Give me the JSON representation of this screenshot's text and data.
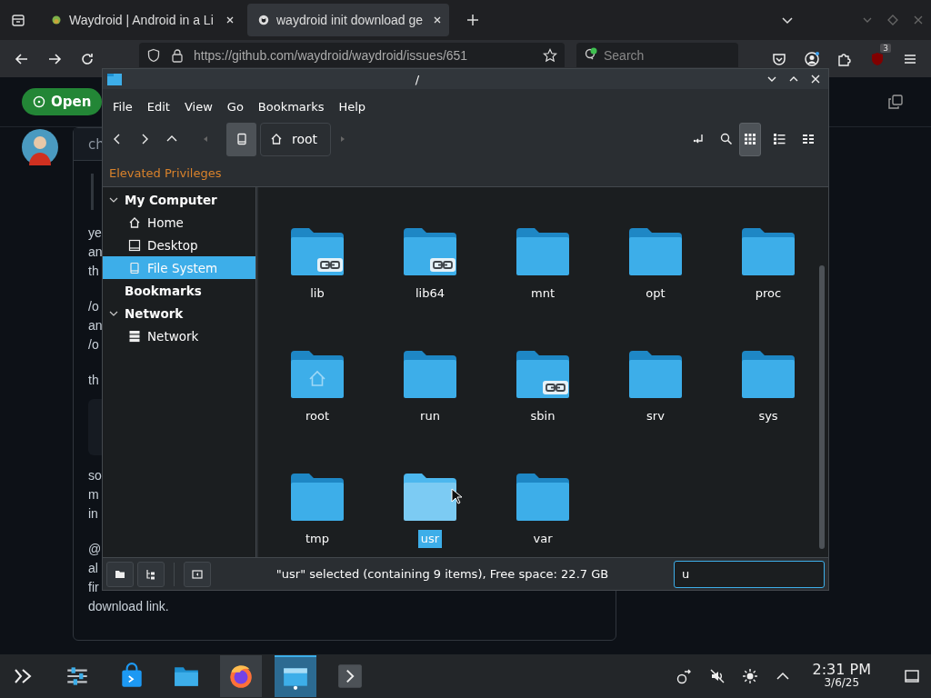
{
  "browser": {
    "tabs": [
      {
        "title": "Waydroid | Android in a Li",
        "selected": false
      },
      {
        "title": "waydroid init download ge",
        "selected": true
      }
    ],
    "url": "https://github.com/waydroid/waydroid/issues/651",
    "search": {
      "placeholder": "Search"
    },
    "addon_badge": "3"
  },
  "page": {
    "open_button": "Open",
    "comment_header": "ch",
    "paragraphs": [
      {
        "kind": "text",
        "lines": [
          "ye",
          "an",
          "th"
        ]
      },
      {
        "kind": "text",
        "lines": [
          "/o",
          "an",
          "/o"
        ]
      },
      {
        "kind": "text",
        "lines": [
          "th"
        ]
      },
      {
        "kind": "code"
      },
      {
        "kind": "text",
        "lines": [
          "so",
          "m",
          "in"
        ]
      },
      {
        "kind": "text",
        "lines": [
          "@",
          "al",
          "fir",
          "download link."
        ]
      }
    ]
  },
  "file_manager": {
    "title": "/",
    "menu": [
      "File",
      "Edit",
      "View",
      "Go",
      "Bookmarks",
      "Help"
    ],
    "breadcrumb": "root",
    "notice": "Elevated Privileges",
    "places": [
      {
        "label": "My Computer",
        "expanded": true,
        "children": [
          {
            "label": "Home",
            "kind": "home",
            "selected": false
          },
          {
            "label": "Desktop",
            "kind": "desktop",
            "selected": false
          },
          {
            "label": "File System",
            "kind": "drive",
            "selected": true
          }
        ]
      },
      {
        "label": "Bookmarks"
      },
      {
        "label": "Network",
        "expanded": true,
        "children": [
          {
            "label": "Network",
            "kind": "server",
            "selected": false
          }
        ]
      }
    ],
    "view_modes": [
      {
        "kind": "icons",
        "selected": true
      },
      {
        "kind": "details",
        "selected": false
      },
      {
        "kind": "compact",
        "selected": false
      }
    ],
    "items": [
      {
        "name": "lib",
        "kind": "link",
        "selected": false
      },
      {
        "name": "lib64",
        "kind": "link",
        "selected": false
      },
      {
        "name": "mnt",
        "kind": "folder",
        "selected": false
      },
      {
        "name": "opt",
        "kind": "folder",
        "selected": false
      },
      {
        "name": "proc",
        "kind": "folder",
        "selected": false
      },
      {
        "name": "root",
        "kind": "home",
        "selected": false
      },
      {
        "name": "run",
        "kind": "folder",
        "selected": false
      },
      {
        "name": "sbin",
        "kind": "link",
        "selected": false
      },
      {
        "name": "srv",
        "kind": "folder",
        "selected": false
      },
      {
        "name": "sys",
        "kind": "folder",
        "selected": false
      },
      {
        "name": "tmp",
        "kind": "folder",
        "selected": false
      },
      {
        "name": "usr",
        "kind": "folder",
        "selected": true
      },
      {
        "name": "var",
        "kind": "folder",
        "selected": false
      }
    ],
    "status": "\"usr\" selected (containing 9 items), Free space: 22.7 GB",
    "filter": {
      "value": "u"
    }
  },
  "taskbar": {
    "apps": [
      {
        "kind": "settings",
        "active": false
      },
      {
        "kind": "store",
        "active": false
      },
      {
        "kind": "files",
        "active": false
      },
      {
        "kind": "firefox",
        "active": true
      },
      {
        "kind": "dolphin",
        "active": true
      },
      {
        "kind": "terminal",
        "active": false
      }
    ],
    "clock": {
      "time": "2:31 PM",
      "date": "3/6/25"
    }
  }
}
